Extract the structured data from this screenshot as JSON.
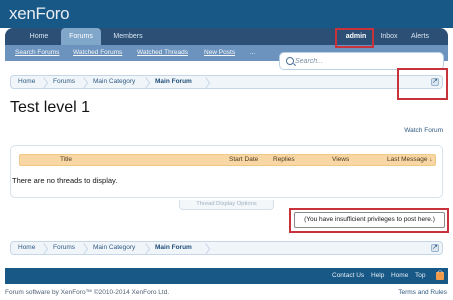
{
  "header": {
    "logo": "xenForo"
  },
  "nav": {
    "tabs": [
      "Home",
      "Forums",
      "Members"
    ],
    "user": {
      "name": "admin",
      "inbox": "Inbox",
      "alerts": "Alerts"
    }
  },
  "subnav": {
    "links": [
      "Search Forums",
      "Watched Forums",
      "Watched Threads",
      "New Posts",
      "..."
    ]
  },
  "search": {
    "placeholder": "Search..."
  },
  "breadcrumb": {
    "items": [
      "Home",
      "Forums",
      "Main Category",
      "Main Forum"
    ]
  },
  "page": {
    "title": "Test level 1",
    "watch": "Watch Forum"
  },
  "threads": {
    "columns": [
      "Title",
      "Start Date",
      "Replies",
      "Views",
      "Last Message ↓"
    ],
    "empty": "There are no threads to display."
  },
  "thread_display_options": "Thread Display Options",
  "notice": "(You have insufficient privileges to post here.)",
  "footer": {
    "links": [
      "Contact Us",
      "Help",
      "Home",
      "Top"
    ],
    "copyright": "Forum software by XenForo™ ©2010-2014 XenForo Ltd.",
    "terms": "Terms and Rules"
  },
  "colors": {
    "header": "#185886",
    "nav": "#2b4f75",
    "subnav": "#6b93be",
    "highlight": "#c8333b",
    "table_head": "#f8d7a5"
  }
}
